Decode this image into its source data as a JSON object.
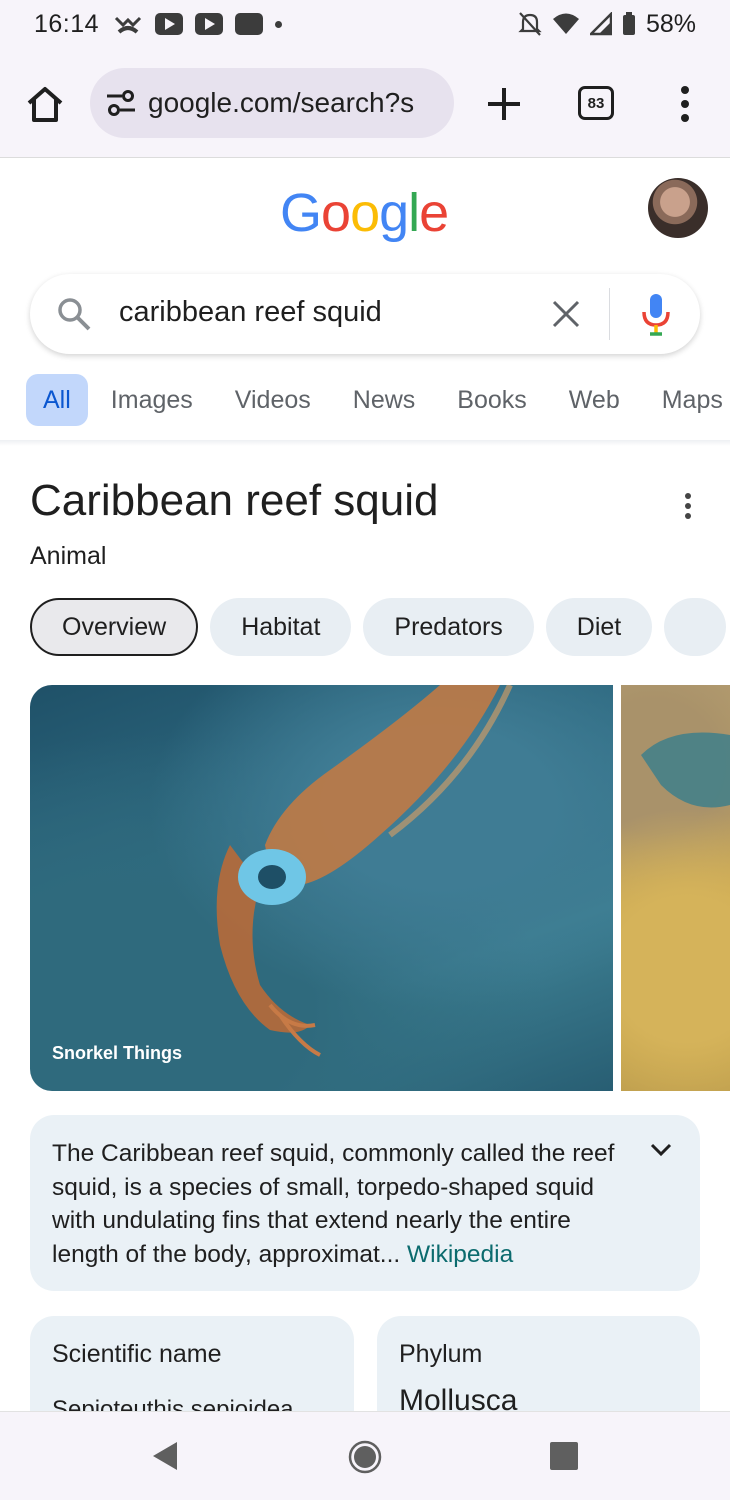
{
  "status_bar": {
    "time": "16:14",
    "battery": "58%"
  },
  "browser": {
    "url": "google.com/search?s",
    "tab_count": "83"
  },
  "google": {
    "logo_text": [
      "G",
      "o",
      "o",
      "g",
      "l",
      "e"
    ],
    "logo_colors": [
      "#4285F4",
      "#EA4335",
      "#FBBC05",
      "#4285F4",
      "#34A853",
      "#EA4335"
    ]
  },
  "search": {
    "query": "caribbean reef squid"
  },
  "search_tabs": [
    "All",
    "Images",
    "Videos",
    "News",
    "Books",
    "Web",
    "Maps"
  ],
  "knowledge_panel": {
    "title": "Caribbean reef squid",
    "subtitle": "Animal",
    "chips": [
      "Overview",
      "Habitat",
      "Predators",
      "Diet",
      ""
    ],
    "image_credit": "Snorkel Things",
    "description": "The Caribbean reef squid, commonly called the reef squid, is a species of small, torpedo-shaped squid with undulating fins that extend nearly the entire length of the body, approximat",
    "description_ellipsis": "... ",
    "source_link": "Wikipedia",
    "facts": [
      {
        "label": "Scientific name",
        "value": "Sepioteuthis sepioidea"
      },
      {
        "label": "Phylum",
        "value": "Mollusca"
      }
    ]
  },
  "colors": {
    "accent": "#0b57d0",
    "active_tab_bg": "#c2d7fb",
    "link": "#0b6b6e"
  }
}
